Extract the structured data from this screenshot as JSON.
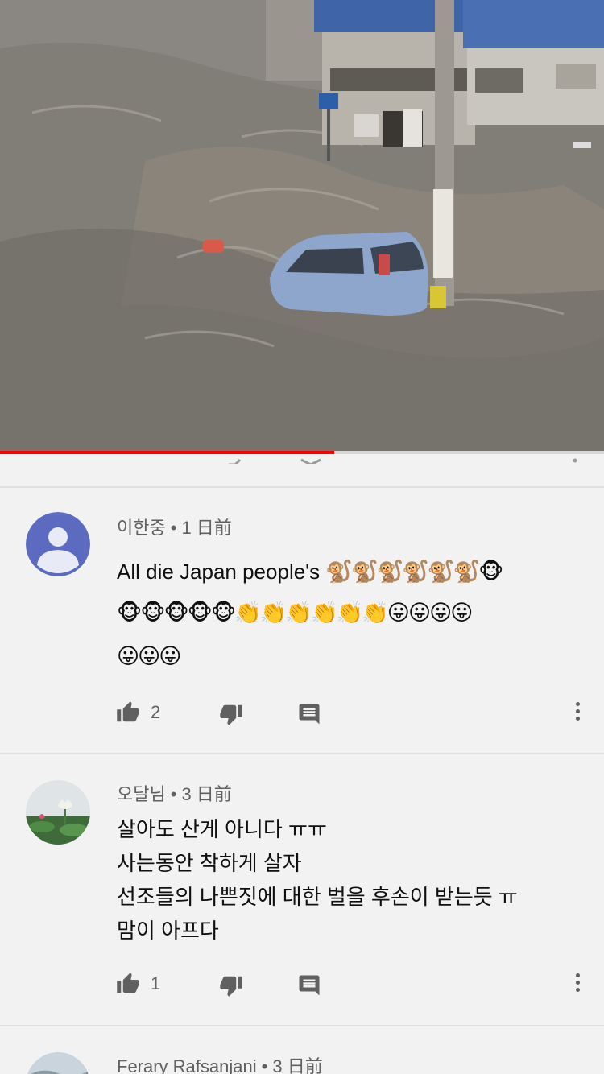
{
  "player": {
    "progress_fraction": 0.553
  },
  "comments": [
    {
      "author": "이한중",
      "time": "1 日前",
      "text_lines": [
        "All die Japan people's"
      ],
      "emoji_lines": [
        "🐒🐒🐒🐒🐒🐒🐵",
        "🐵🐵🐵🐵🐵👏👏👏👏👏👏😛😛😛😛",
        "😛😛😛"
      ],
      "likes": "2",
      "avatar": "default-person",
      "avatar_color": "#5c6bc0"
    },
    {
      "author": "오달님",
      "time": "3 日前",
      "text_lines": [
        "살아도 산게 아니다 ㅠㅠ",
        "사는동안 착하게 살자",
        "선조들의 나쁜짓에 대한 벌을 후손이 받는듯 ㅠ",
        "맘이 아프다"
      ],
      "emoji_lines": [],
      "likes": "1",
      "avatar": "lotus-photo"
    },
    {
      "author": "Ferary Rafsanjani",
      "time": "3 日前",
      "avatar": "landscape-photo"
    }
  ],
  "icons": {
    "like": "thumbs-up-icon",
    "dislike": "thumbs-down-icon",
    "reply": "reply-comment-icon",
    "more": "more-vertical-icon"
  },
  "colors": {
    "progress": "#ff0000",
    "meta_text": "#606060",
    "background": "#f2f2f2"
  }
}
